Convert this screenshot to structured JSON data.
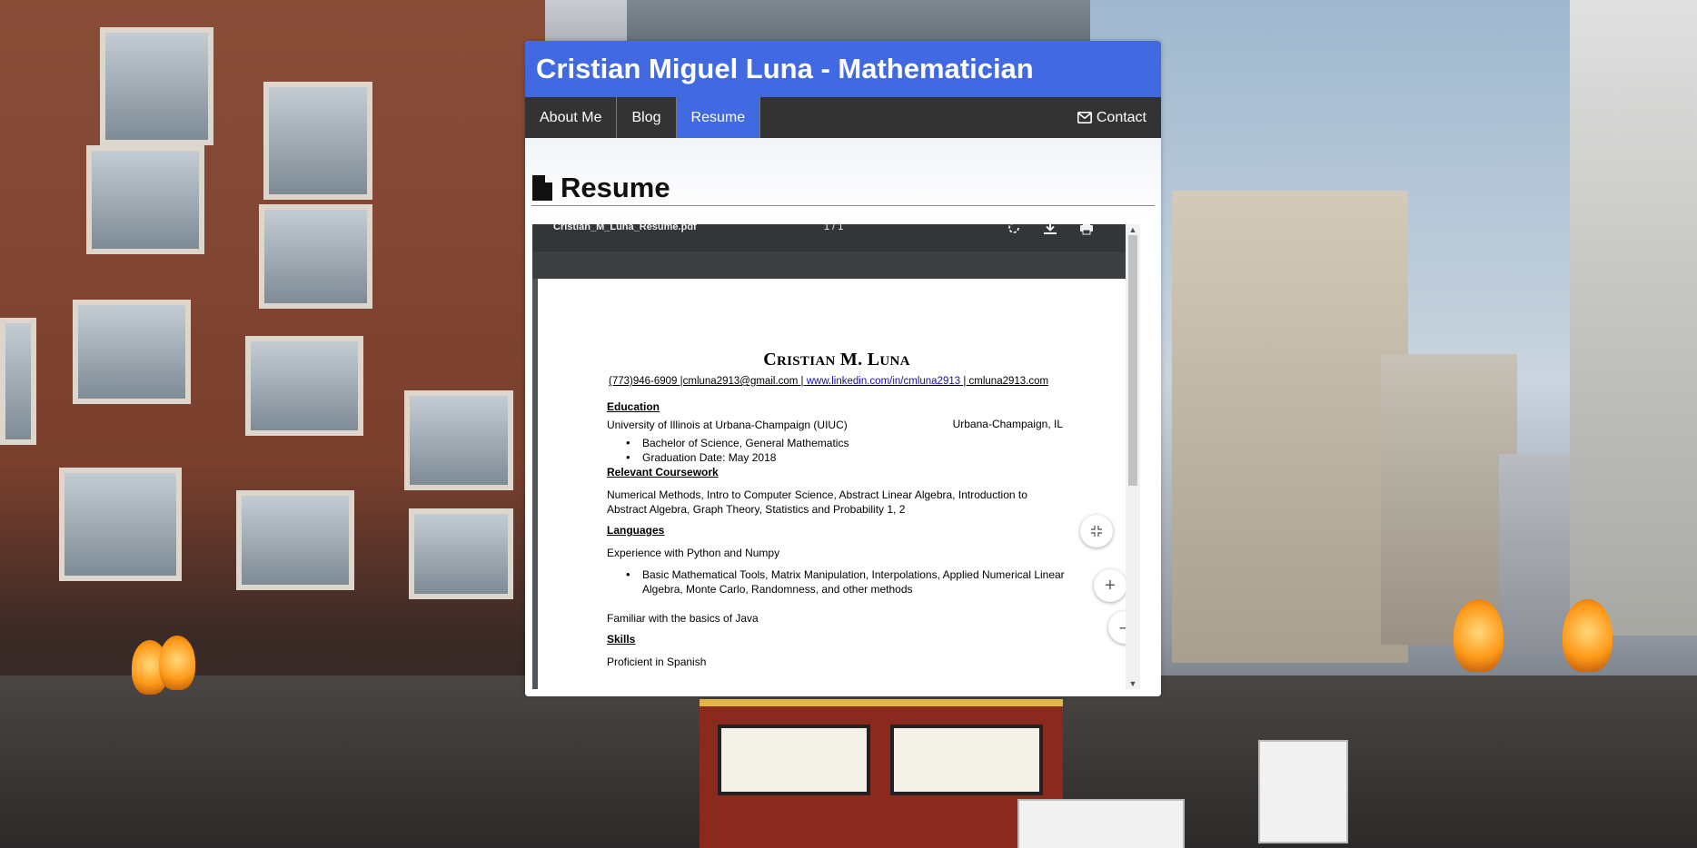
{
  "site": {
    "title": "Cristian Miguel Luna - Mathematician"
  },
  "nav": {
    "items": [
      {
        "label": "About Me"
      },
      {
        "label": "Blog"
      },
      {
        "label": "Resume"
      }
    ],
    "contact_label": "Contact",
    "active": "Resume"
  },
  "section": {
    "title": "Resume",
    "icon": "file-icon"
  },
  "pdf_viewer": {
    "filename": "Cristian_M_Luna_Resume.pdf",
    "page_indicator": "1 / 1",
    "toolbar_icons": [
      "rotate-icon",
      "download-icon",
      "print-icon"
    ],
    "zoom_controls": [
      "fit-page-icon",
      "zoom-in-icon",
      "zoom-out-icon"
    ]
  },
  "resume": {
    "name_first_initial": "C",
    "name_first_rest": "RISTIAN",
    "name_mid": "M.",
    "name_last_initial": "L",
    "name_last_rest": "UNA",
    "contact_prefix": "(773)946-6909 |cmluna2913@gmail.com | ",
    "contact_link": "www.linkedin.com/in/cmluna2913",
    "contact_suffix": " | cmluna2913.com",
    "education_heading": "Education",
    "university": "University of Illinois at Urbana-Champaign (UIUC)",
    "location": "Urbana-Champaign, IL",
    "education_items": [
      "Bachelor of Science, General Mathematics",
      "Graduation Date: May 2018"
    ],
    "coursework_heading": "Relevant Coursework",
    "coursework_line1": "Numerical Methods, Intro to Computer Science, Abstract Linear Algebra, Introduction to",
    "coursework_line2": "Abstract Algebra, Graph Theory, Statistics and Probability 1, 2",
    "languages_heading": "Languages",
    "languages_line": "Experience with Python and Numpy",
    "languages_item_line1": "Basic Mathematical Tools, Matrix Manipulation, Interpolations, Applied Numerical Linear",
    "languages_item_line2": "Algebra, Monte Carlo, Randomness, and other methods",
    "java_line": "Familiar with the basics of Java",
    "skills_heading": "Skills",
    "skills_line": "Proficient in Spanish"
  },
  "colors": {
    "header_bg": "#4169e1",
    "nav_bg": "#333333",
    "active_tab": "#4169e1"
  }
}
